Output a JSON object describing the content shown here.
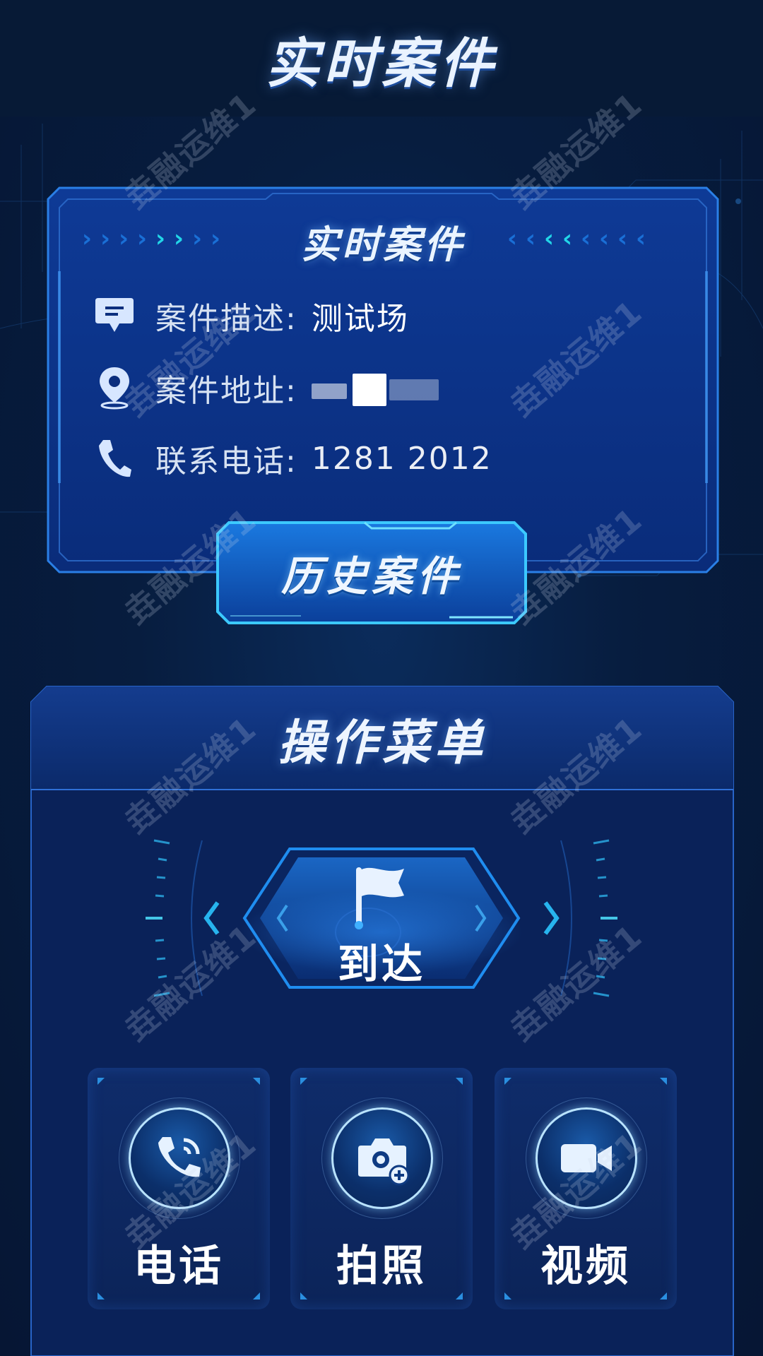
{
  "header": {
    "title": "实时案件"
  },
  "case_card": {
    "title": "实时案件",
    "fields": [
      {
        "label": "案件描述:",
        "value": "测试场",
        "icon": "message-icon"
      },
      {
        "label": "案件地址:",
        "value": "[redacted]",
        "icon": "location-pin-icon"
      },
      {
        "label": "联系电话:",
        "value": "1281 2012",
        "icon": "phone-icon"
      }
    ],
    "history_button": "历史案件"
  },
  "ops_menu": {
    "title": "操作菜单",
    "arrive_button": {
      "label": "到达",
      "icon": "flag-icon"
    },
    "tiles": [
      {
        "label": "电话",
        "icon": "phone-call-icon"
      },
      {
        "label": "拍照",
        "icon": "camera-add-icon"
      },
      {
        "label": "视频",
        "icon": "video-camera-icon"
      }
    ]
  },
  "watermark": "垚融运维1",
  "colors": {
    "accent": "#22d6e8",
    "frame_blue": "#2a7fe6",
    "panel": "#0c2a75",
    "background": "#061634"
  }
}
